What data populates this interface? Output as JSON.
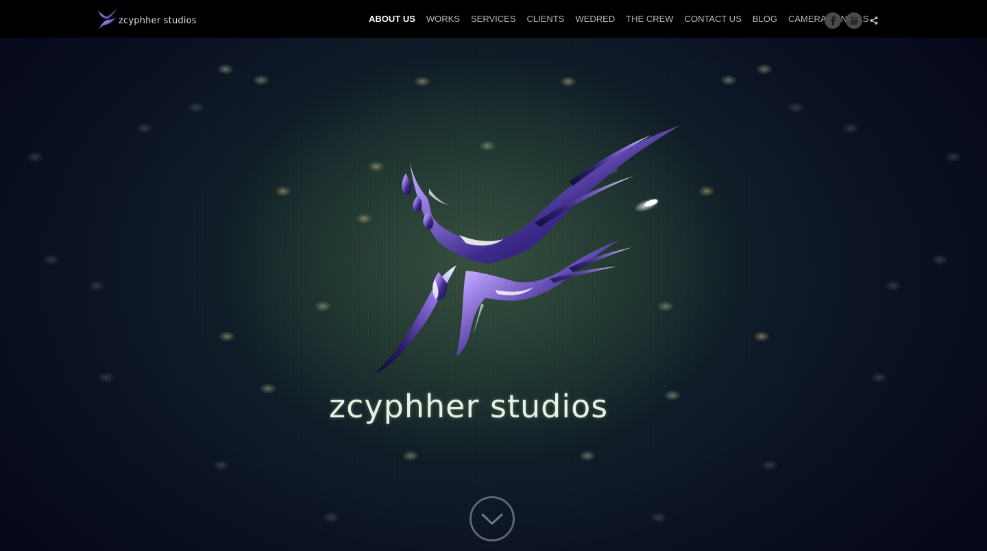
{
  "brand": {
    "name": "zcyphher studios",
    "logo_icon": "splash-logo-icon"
  },
  "nav": {
    "items": [
      {
        "label": "ABOUT US",
        "active": true
      },
      {
        "label": "WORKS",
        "active": false
      },
      {
        "label": "SERVICES",
        "active": false
      },
      {
        "label": "CLIENTS",
        "active": false
      },
      {
        "label": "WEDRED",
        "active": false
      },
      {
        "label": "THE CREW",
        "active": false
      },
      {
        "label": "CONTACT US",
        "active": false
      },
      {
        "label": "BLOG",
        "active": false
      },
      {
        "label": "CAMERA RENTALS",
        "active": false
      }
    ],
    "social": [
      {
        "icon": "facebook-icon"
      },
      {
        "icon": "youtube-icon"
      },
      {
        "icon": "share-icon"
      }
    ]
  },
  "hero": {
    "title": "zcyphher studios",
    "scroll_icon": "chevron-down-icon"
  },
  "colors": {
    "navbar_bg": "#000000",
    "nav_text": "#b9b9b9",
    "nav_active": "#ffffff",
    "logo_purple": "#5a3fa8",
    "title_text": "#e8f2e2"
  }
}
